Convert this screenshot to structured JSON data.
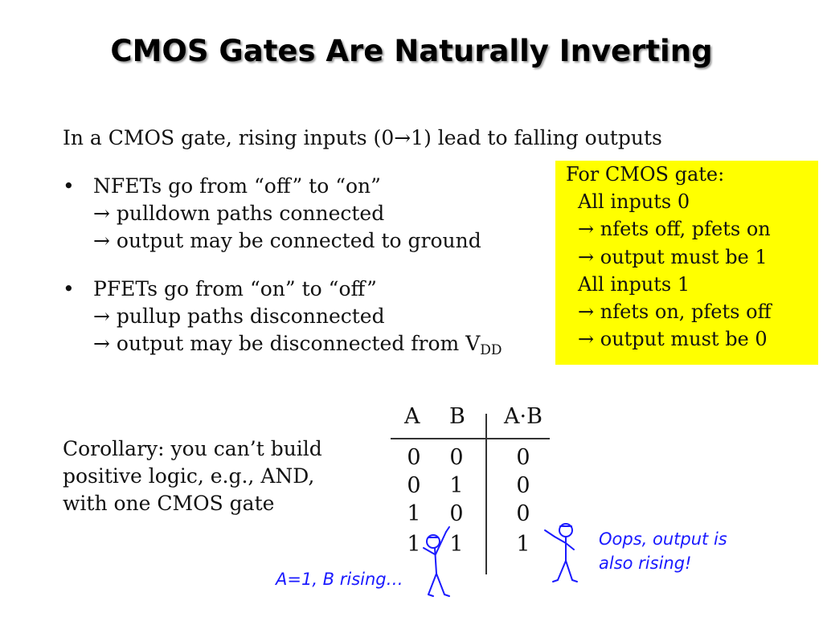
{
  "slide": {
    "title": "CMOS Gates Are Naturally Inverting",
    "intro": "In a CMOS gate, rising inputs (0→1) lead to falling outputs",
    "bullets": [
      {
        "marker": "•",
        "lines": [
          "NFETs go from “off” to “on”",
          "→ pulldown paths connected",
          "→ output may be connected to ground"
        ]
      },
      {
        "marker": "•",
        "lines": [
          "PFETs go from “on” to “off”",
          "→ pullup paths disconnected",
          "→ output may be disconnected from V"
        ],
        "subscript": "DD"
      }
    ],
    "callout": {
      "background": "#ffff00",
      "lines": [
        "For CMOS gate:",
        "All inputs 0",
        "→ nfets off, pfets on",
        "→ output must be 1",
        "All inputs 1",
        "→ nfets on, pfets off",
        "→ output must be 0"
      ]
    },
    "corollary": [
      "Corollary: you can’t build",
      "positive logic, e.g., AND,",
      "with one CMOS gate"
    ],
    "truth_table": {
      "headers": [
        "A",
        "B",
        "A·B"
      ],
      "rows": [
        [
          "0",
          "0",
          "0"
        ],
        [
          "0",
          "1",
          "0"
        ],
        [
          "1",
          "0",
          "0"
        ],
        [
          "1",
          "1",
          "1"
        ]
      ]
    },
    "notes": {
      "left": "A=1, B rising…",
      "right": [
        "Oops, output is",
        "also rising!"
      ],
      "color": "#1a1aff"
    }
  }
}
